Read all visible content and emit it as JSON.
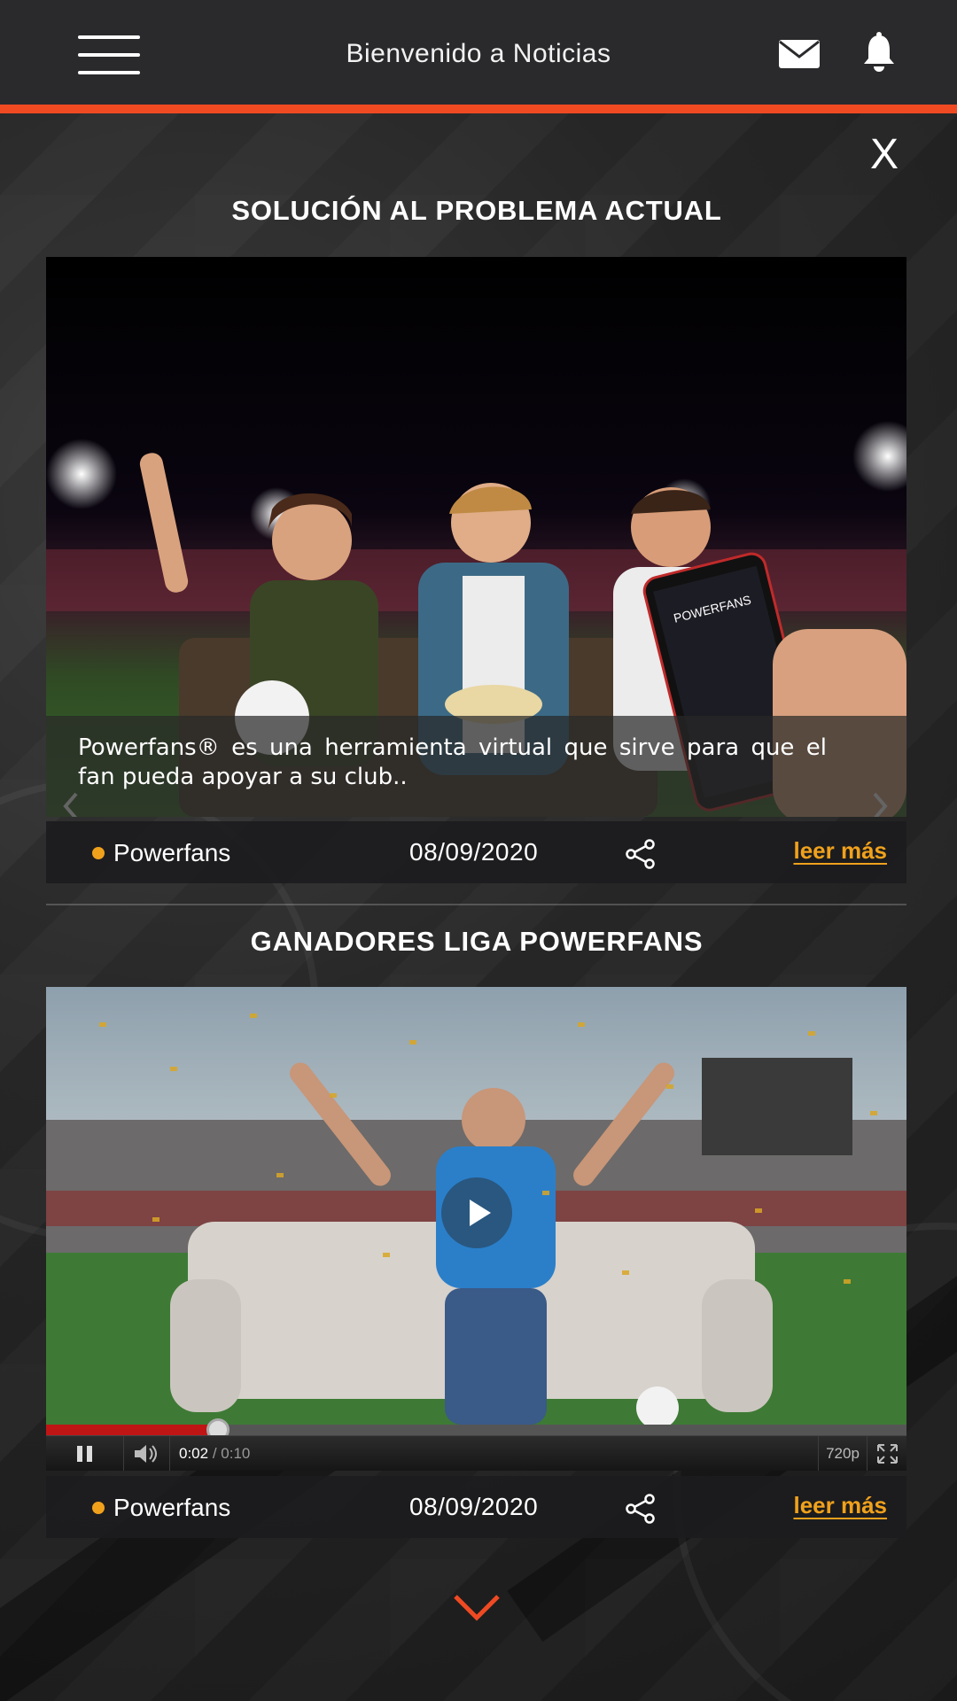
{
  "header": {
    "title": "Bienvenido  a Noticias",
    "icons": [
      "menu-icon",
      "mail-icon",
      "bell-icon"
    ]
  },
  "colors": {
    "accent": "#f04a23",
    "link": "#f0a11c",
    "dot": "#f0a11c",
    "header_bg": "#2a2a2c"
  },
  "close_label": "X",
  "news": [
    {
      "title": "SOLUCIÓN AL PROBLEMA ACTUAL",
      "caption": "Powerfans® es una herramienta virtual que sirve para que el fan pueda apoyar a su club..",
      "source": "Powerfans",
      "date": "08/09/2020",
      "read_more": "leer más",
      "media_type": "image-carousel",
      "icons": [
        "chevron-left-icon",
        "chevron-right-icon",
        "share-icon"
      ]
    },
    {
      "title": "GANADORES LIGA POWERFANS",
      "source": "Powerfans",
      "date": "08/09/2020",
      "read_more": "leer más",
      "media_type": "video",
      "video": {
        "current_time": "0:02",
        "separator": " / ",
        "duration": "0:10",
        "quality": "720p",
        "progress": 0.2
      },
      "icons": [
        "play-icon",
        "pause-icon",
        "volume-icon",
        "fullscreen-icon",
        "share-icon"
      ]
    }
  ],
  "scroll_icon": "chevron-down-icon"
}
